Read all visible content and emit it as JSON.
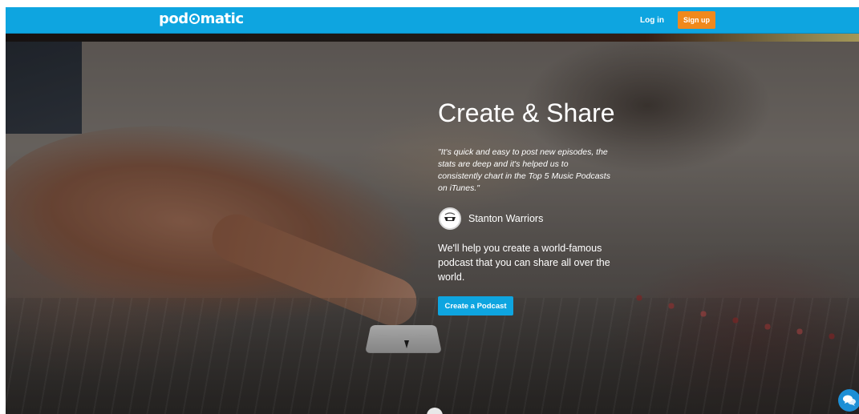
{
  "header": {
    "logo_prefix": "pod",
    "logo_suffix": "matic",
    "login_label": "Log in",
    "signup_label": "Sign up"
  },
  "hero": {
    "title": "Create & Share",
    "quote": "\"It's quick and easy to post new episodes, the stats are deep and it's helped us to consistently chart in the Top 5 Music Podcasts on iTunes.\"",
    "author_name": "Stanton Warriors",
    "pitch": "We'll help you create a world-famous podcast that you can share all over the world.",
    "cta_label": "Create a Podcast"
  },
  "colors": {
    "brand_blue": "#0ea5e0",
    "signup_orange": "#f0891c",
    "chat_blue": "#1c8fd6"
  },
  "icons": {
    "author_avatar": "author-avatar-icon",
    "chat": "chat-bubble-icon"
  }
}
